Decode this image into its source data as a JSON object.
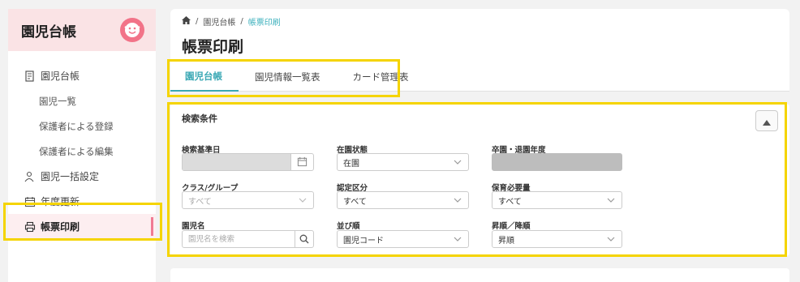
{
  "sidebar": {
    "title": "園児台帳",
    "sections": [
      {
        "label": "園児台帳",
        "icon": "ledger-icon"
      },
      {
        "label": "園児一括設定",
        "icon": "people-settings-icon"
      },
      {
        "label": "年度更新",
        "icon": "calendar-icon"
      },
      {
        "label": "帳票印刷",
        "icon": "printer-icon"
      }
    ],
    "subitems": [
      "園児一覧",
      "保護者による登録",
      "保護者による編集"
    ]
  },
  "breadcrumb": {
    "item1": "園児台帳",
    "separator": "/",
    "current": "帳票印刷"
  },
  "page_title": "帳票印刷",
  "tabs": [
    "園児台帳",
    "園児情報一覧表",
    "カード管理表"
  ],
  "filter": {
    "section_title": "検索条件",
    "fields": {
      "base_date": {
        "label": "検索基準日"
      },
      "enrollment_status": {
        "label": "在園状態",
        "value": "在園"
      },
      "graduation_year": {
        "label": "卒園・退園年度"
      },
      "class_group": {
        "label": "クラス/グループ",
        "value": "すべて"
      },
      "certification": {
        "label": "認定区分",
        "value": "すべて"
      },
      "childcare_need": {
        "label": "保育必要量",
        "value": "すべて"
      },
      "child_name": {
        "label": "園児名",
        "placeholder": "園児名を検索"
      },
      "sort_by": {
        "label": "並び順",
        "value": "園児コード"
      },
      "sort_order": {
        "label": "昇順／降順",
        "value": "昇順"
      }
    }
  },
  "colors": {
    "accent": "#3aa8b4",
    "highlight": "#f5d400",
    "sidebar_header": "#fae3e5",
    "logo": "#f27388"
  }
}
